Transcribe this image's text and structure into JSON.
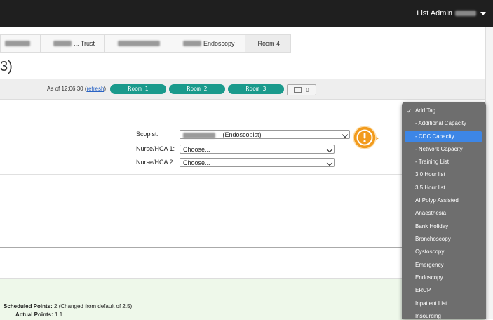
{
  "header": {
    "user_label": "List Admin"
  },
  "breadcrumb": {
    "items": [
      {
        "label": ""
      },
      {
        "label": "... Trust"
      },
      {
        "label": ""
      },
      {
        "label": "Endoscopy"
      },
      {
        "label": "Room 4"
      }
    ]
  },
  "page": {
    "title": "3)"
  },
  "status": {
    "as_of": "As of 12:06:30",
    "refresh_open": "(",
    "refresh_label": "refresh",
    "refresh_close": ")",
    "rooms": [
      "Room 1",
      "Room 2",
      "Room 3"
    ],
    "message_count": "0"
  },
  "form": {
    "scopist_label": "Scopist:",
    "scopist_value": "(Endoscopist)",
    "nurse1_label": "Nurse/HCA 1:",
    "nurse1_value": "Choose...",
    "nurse2_label": "Nurse/HCA 2:",
    "nurse2_value": "Choose..."
  },
  "points": {
    "scheduled_label": "Scheduled Points:",
    "scheduled_value": "2 (Changed from default of 2.5)",
    "actual_label": "Actual Points:",
    "actual_value": "1.1"
  },
  "tag_menu": {
    "items": [
      "Add Tag...",
      "- Additional Capacity",
      "- CDC Capacity",
      "- Network Capacity",
      "- Training List",
      "3.0 Hour list",
      "3.5 Hour list",
      "AI Polyp Assisted",
      "Anaesthesia",
      "Bank Holiday",
      "Bronchoscopy",
      "Cystoscopy",
      "Emergency",
      "Endoscopy",
      "ERCP",
      "Inpatient List",
      "Insourcing"
    ],
    "checked_index": 0,
    "selected_index": 2
  },
  "colors": {
    "room_pill": "#1a9a8c",
    "menu_bg": "#6e6e6e",
    "menu_selected": "#3d86e6",
    "callout": "#f29b1d",
    "points_panel": "#eef8ea"
  },
  "icons": {
    "callout": "exclamation-icon",
    "message": "envelope-icon",
    "check": "checkmark-icon"
  }
}
